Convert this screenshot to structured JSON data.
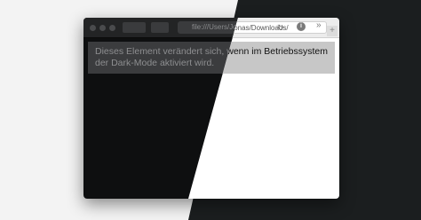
{
  "browser": {
    "address_url": "file:///Users/Jonas/Downloads/",
    "reload_icon": "reload-icon",
    "info_icon": "info-icon",
    "info_label": "i",
    "overflow_label": "»",
    "new_tab_label": "+"
  },
  "content": {
    "text": "Dieses Element verändert sich, wenn im Betriebssystem der Dark-Mode aktiviert wird."
  },
  "colors": {
    "dark_background": "#1b1e1f",
    "light_background": "#f3f3f3",
    "dark_box": "#3b3c3e",
    "light_box": "#c7c7c7"
  }
}
